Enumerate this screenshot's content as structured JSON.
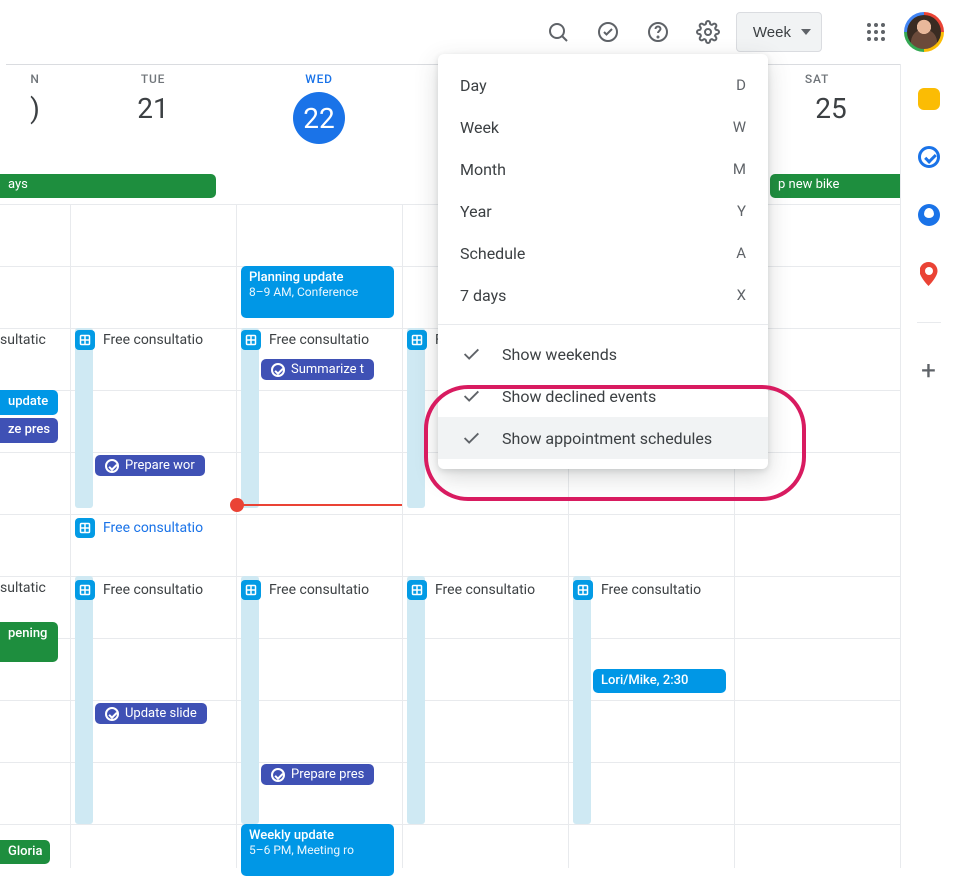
{
  "topbar": {
    "view_label": "Week"
  },
  "days": [
    {
      "dow": "N",
      "num": ")"
    },
    {
      "dow": "TUE",
      "num": "21"
    },
    {
      "dow": "WED",
      "num": "22",
      "today": true
    },
    {
      "dow": "",
      "num": ""
    },
    {
      "dow": "",
      "num": ""
    },
    {
      "dow": "SAT",
      "num": "25"
    }
  ],
  "menu": {
    "views": [
      {
        "label": "Day",
        "key": "D"
      },
      {
        "label": "Week",
        "key": "W"
      },
      {
        "label": "Month",
        "key": "M"
      },
      {
        "label": "Year",
        "key": "Y"
      },
      {
        "label": "Schedule",
        "key": "A"
      },
      {
        "label": "7 days",
        "key": "X"
      }
    ],
    "toggles": [
      {
        "label": "Show weekends"
      },
      {
        "label": "Show declined events"
      },
      {
        "label": "Show appointment schedules",
        "hover": true
      }
    ]
  },
  "allday": {
    "mon_ays": "ays",
    "sat_bike": "p new bike"
  },
  "events": {
    "planning_title": "Planning update",
    "planning_sub": "8–9 AM, Conference",
    "weekly_title": "Weekly update",
    "weekly_sub": "5–6 PM, Meeting ro",
    "lori_mike": "Lori/Mike, 2:30",
    "update": "update",
    "ze_pres": "ze pres",
    "pening": "pening",
    "gloria": "Gloria",
    "sultatic": "sultatic",
    "free_consult": "Free consultatio",
    "free_consult_short": "Fr",
    "summarize": "Summarize t",
    "prepare_work": "Prepare wor",
    "prepare_pres": "Prepare pres",
    "update_slides": "Update slide"
  },
  "colors": {
    "blue": "#0097e6",
    "green": "#1e8e3e",
    "indigo": "#3f51b5",
    "accent": "#1a73e8",
    "ring": "#d81b60"
  }
}
